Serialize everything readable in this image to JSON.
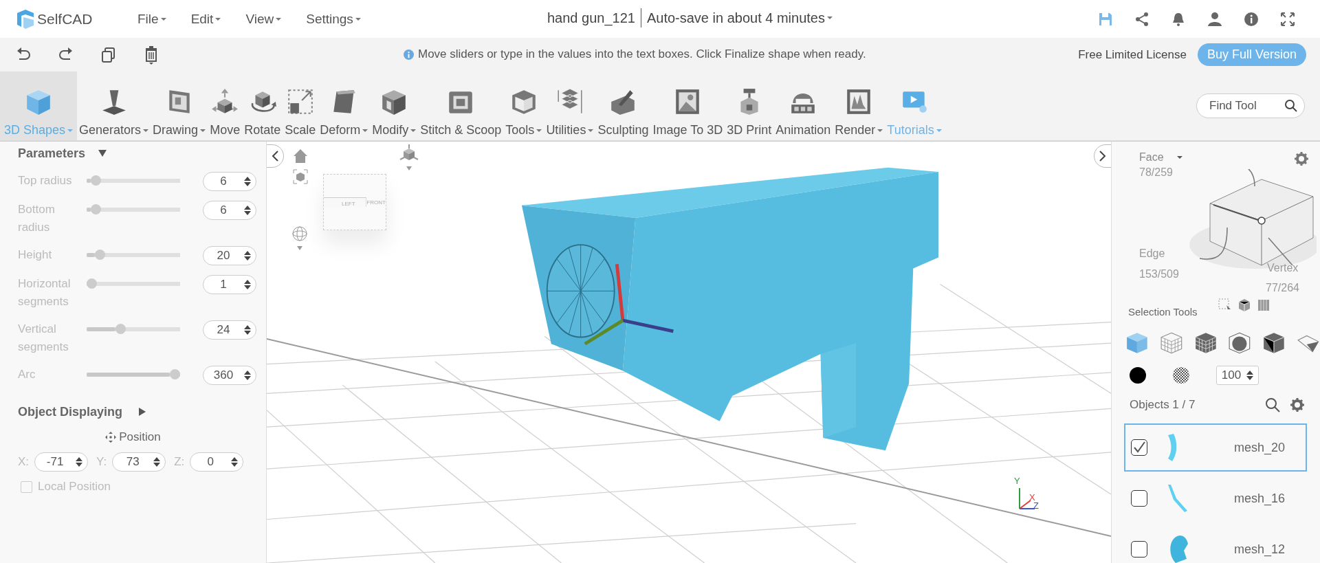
{
  "app_bar": {
    "logo": "SelfCAD",
    "menus": [
      {
        "label": "File"
      },
      {
        "label": "Edit"
      },
      {
        "label": "View"
      },
      {
        "label": "Settings"
      }
    ],
    "project_title": "hand gun_121",
    "autosave": "Auto-save in about 4 minutes"
  },
  "info_bar": {
    "message": "Move sliders or type in the values into the text boxes. Click Finalize shape when ready.",
    "license": "Free Limited License",
    "buy_button": "Buy Full Version"
  },
  "toolbar": {
    "items": [
      {
        "label": "3D Shapes",
        "dropdown": true,
        "selected": true,
        "kind": "tool"
      },
      {
        "label": "Generators",
        "dropdown": true,
        "selected": false,
        "kind": "tool"
      },
      {
        "label": "Drawing",
        "dropdown": true,
        "selected": false,
        "kind": "tool"
      },
      {
        "label": "Move",
        "dropdown": false,
        "selected": false,
        "kind": "tool"
      },
      {
        "label": "Rotate",
        "dropdown": false,
        "selected": false,
        "kind": "tool"
      },
      {
        "label": "Scale",
        "dropdown": false,
        "selected": false,
        "kind": "tool"
      },
      {
        "label": "Deform",
        "dropdown": true,
        "selected": false,
        "kind": "tool"
      },
      {
        "label": "Modify",
        "dropdown": true,
        "selected": false,
        "kind": "tool"
      },
      {
        "label": "Stitch & Scoop",
        "dropdown": false,
        "selected": false,
        "kind": "tool"
      },
      {
        "label": "Tools",
        "dropdown": true,
        "selected": false,
        "kind": "tool"
      },
      {
        "label": "Utilities",
        "dropdown": true,
        "selected": false,
        "kind": "tool"
      },
      {
        "label": "Sculpting",
        "dropdown": false,
        "selected": false,
        "kind": "tool"
      },
      {
        "label": "Image To 3D",
        "dropdown": false,
        "selected": false,
        "kind": "tool"
      },
      {
        "label": "3D Print",
        "dropdown": false,
        "selected": false,
        "kind": "tool"
      },
      {
        "label": "Animation",
        "dropdown": false,
        "selected": false,
        "kind": "tool"
      },
      {
        "label": "Render",
        "dropdown": true,
        "selected": false,
        "kind": "tool"
      },
      {
        "label": "Tutorials",
        "dropdown": true,
        "selected": false,
        "kind": "link"
      }
    ],
    "search": {
      "placeholder": "Find Tool"
    }
  },
  "parameters": {
    "title": "Parameters",
    "expanded": true,
    "sliders": [
      {
        "label": "Top radius",
        "level": 0.05,
        "value": "6"
      },
      {
        "label": "Bottom radius",
        "level": 0.05,
        "value": "6"
      },
      {
        "label": "Height",
        "level": 0.1,
        "value": "20"
      },
      {
        "label": "Horizontal segments",
        "level": 0.0,
        "value": "1"
      },
      {
        "label": "Vertical segments",
        "level": 0.35,
        "value": "24"
      },
      {
        "label": "Arc",
        "level": 1.0,
        "value": "360"
      }
    ]
  },
  "object_displaying": {
    "title": "Object Displaying",
    "expanded": false,
    "position_label": "Position",
    "coordinates": [
      {
        "axis": "X:",
        "value": "-71"
      },
      {
        "axis": "Y:",
        "value": "73"
      },
      {
        "axis": "Z:",
        "value": "0"
      }
    ],
    "local_position": {
      "label": "Local Position",
      "checked": false
    }
  },
  "viewport": {
    "view_cube": [
      "LEFT",
      "FRONT"
    ],
    "axes": [
      {
        "label": "Y",
        "color": "#2e9e3e"
      },
      {
        "label": "X",
        "color": "#e03c3c"
      },
      {
        "label": "Z",
        "color": "#3c52d6"
      }
    ]
  },
  "selection_panel": {
    "face": {
      "label": "Face",
      "count": "78/259"
    },
    "edge": {
      "label": "Edge",
      "count": "153/509"
    },
    "vertex": {
      "label": "Vertex",
      "count": "77/264"
    },
    "tools_label": "Selection Tools",
    "modes": [
      {
        "selected": true
      },
      {
        "selected": false
      },
      {
        "selected": false
      },
      {
        "selected": false
      },
      {
        "selected": false
      },
      {
        "selected": false
      }
    ],
    "opacity": "100"
  },
  "objects": {
    "header": "Objects 1 / 7",
    "items": [
      {
        "name": "mesh_20",
        "checked": true,
        "selected": true
      },
      {
        "name": "mesh_16",
        "checked": false,
        "selected": false
      },
      {
        "name": "mesh_12",
        "checked": false,
        "selected": false
      }
    ]
  }
}
